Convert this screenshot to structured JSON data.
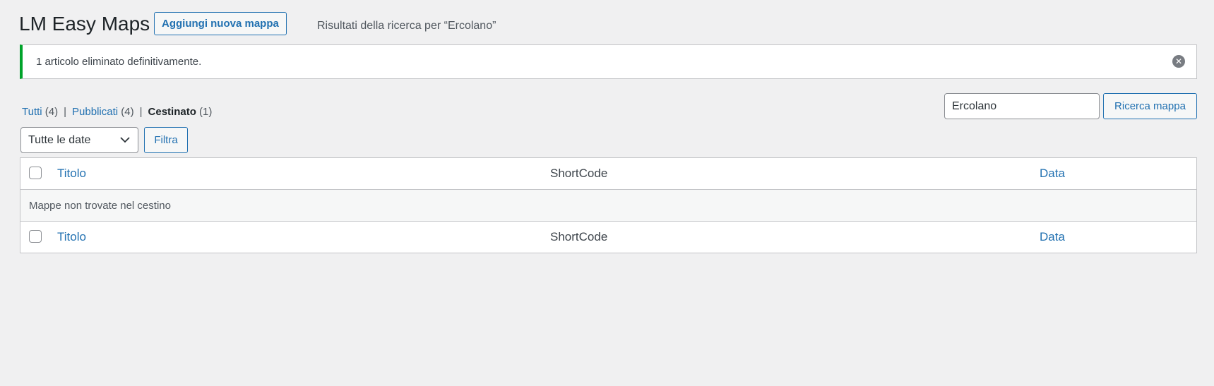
{
  "header": {
    "title": "LM Easy Maps",
    "add_new_label": "Aggiungi nuova mappa",
    "subtitle": "Risultati della ricerca per “Ercolano”"
  },
  "notice": {
    "message": "1 articolo eliminato definitivamente.",
    "dismiss_icon": "close-circle-icon",
    "accent_color": "#00a32a"
  },
  "views": [
    {
      "label": "Tutti",
      "count": "(4)",
      "current": false
    },
    {
      "label": "Pubblicati",
      "count": "(4)",
      "current": false
    },
    {
      "label": "Cestinato",
      "count": "(1)",
      "current": true
    }
  ],
  "search": {
    "value": "Ercolano",
    "button_label": "Ricerca mappa"
  },
  "filters": {
    "date_selected": "Tutte le date",
    "filter_button_label": "Filtra"
  },
  "table": {
    "columns": {
      "title": "Titolo",
      "shortcode": "ShortCode",
      "date": "Data"
    },
    "empty_message": "Mappe non trovate nel cestino"
  },
  "colors": {
    "link": "#2271b1",
    "background": "#f0f0f1"
  }
}
